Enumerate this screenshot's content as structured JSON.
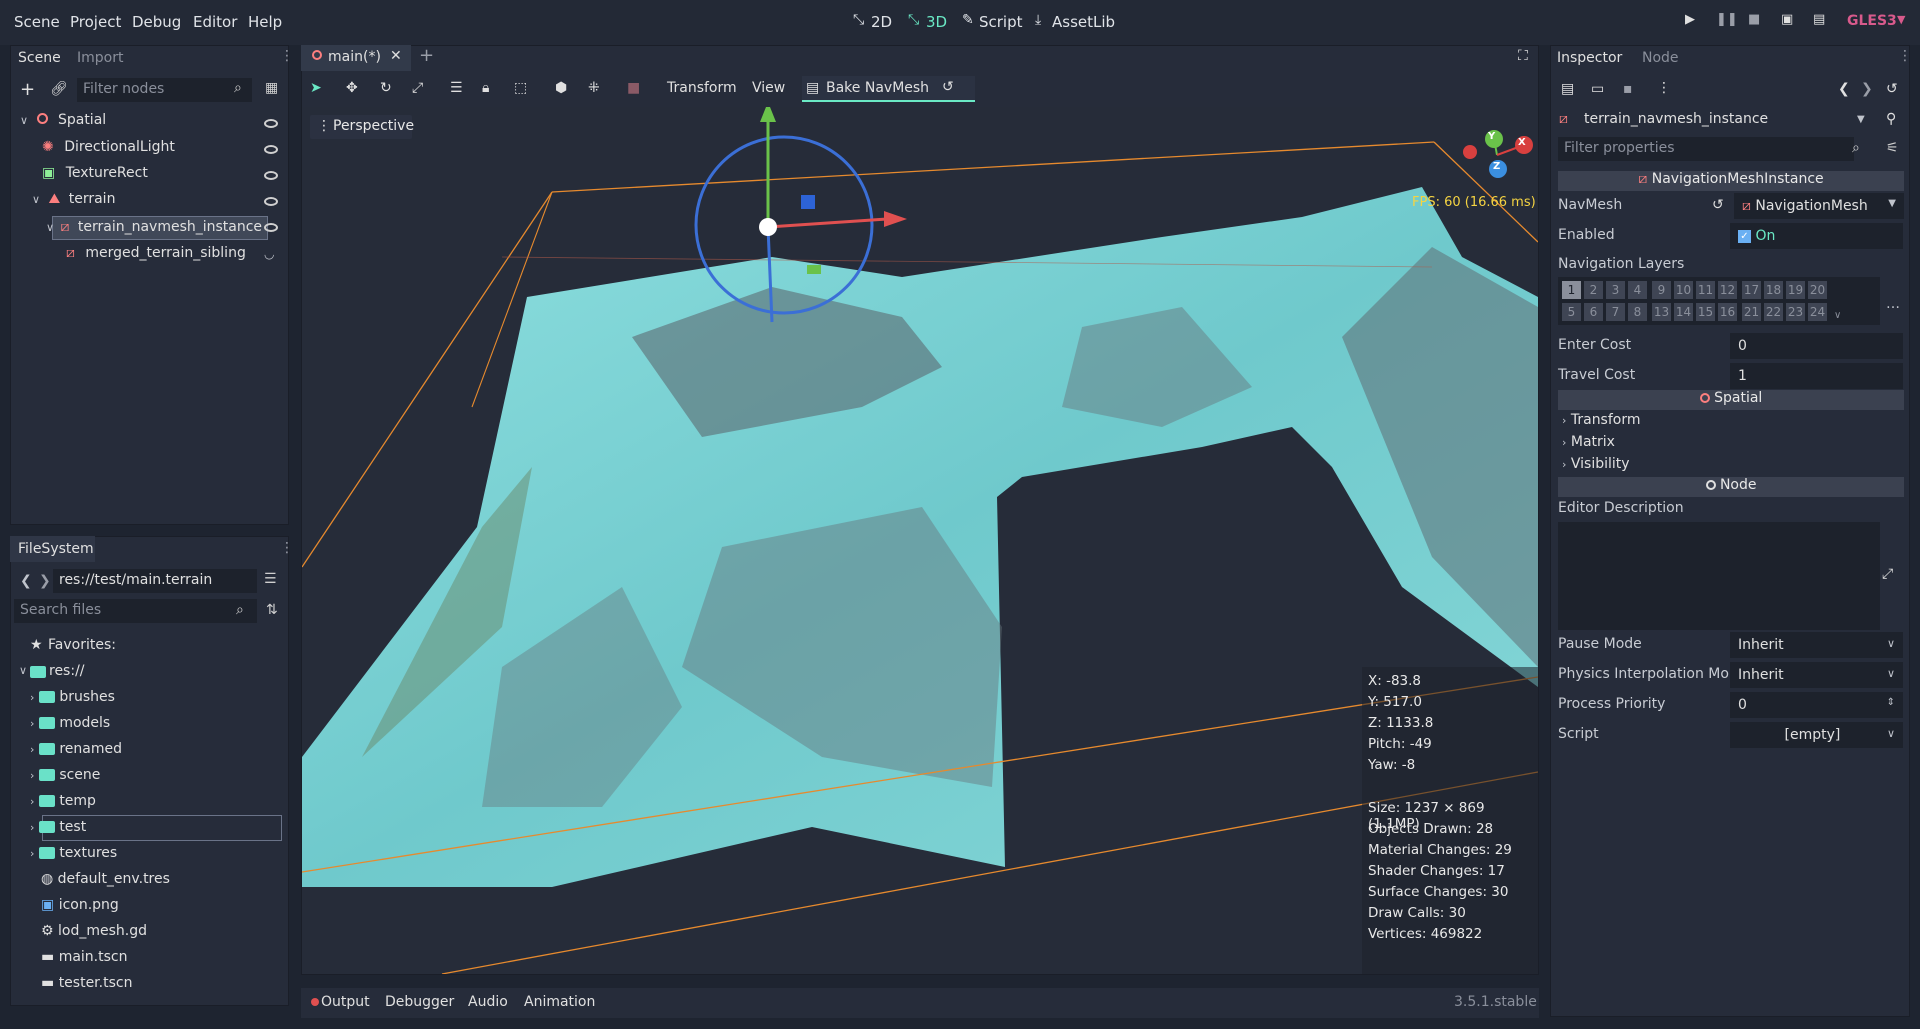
{
  "menu": {
    "scene": "Scene",
    "project": "Project",
    "debug": "Debug",
    "editor": "Editor",
    "help": "Help"
  },
  "modes": {
    "m2d": "2D",
    "m3d": "3D",
    "script": "Script",
    "assetlib": "AssetLib"
  },
  "renderer": "GLES3",
  "scene_dock": {
    "tab_scene": "Scene",
    "tab_import": "Import",
    "filter_placeholder": "Filter nodes",
    "nodes": [
      {
        "label": "Spatial"
      },
      {
        "label": "DirectionalLight"
      },
      {
        "label": "TextureRect"
      },
      {
        "label": "terrain"
      },
      {
        "label": "terrain_navmesh_instance"
      },
      {
        "label": "merged_terrain_sibling"
      }
    ]
  },
  "filesystem": {
    "title": "FileSystem",
    "path": "res://test/main.terrain",
    "search_placeholder": "Search files",
    "favorites": "Favorites:",
    "root": "res://",
    "folders": [
      "brushes",
      "models",
      "renamed",
      "scene",
      "temp",
      "test",
      "textures"
    ],
    "files": [
      "default_env.tres",
      "icon.png",
      "lod_mesh.gd",
      "main.tscn",
      "tester.tscn"
    ]
  },
  "editor_tab": "main(*)",
  "toolbar": {
    "transform": "Transform",
    "view": "View",
    "bake": "Bake NavMesh"
  },
  "viewport": {
    "perspective": "Perspective",
    "fps": "FPS: 60 (16.66 ms)",
    "gizmo": {
      "y": "Y",
      "x": "X",
      "z": "Z"
    },
    "camera": [
      "X: -83.8",
      "Y: 517.0",
      "Z: 1133.8",
      "Pitch: -49",
      "Yaw: -8"
    ],
    "stats": [
      "Size: 1237 × 869 (1.1MP)",
      "Objects Drawn: 28",
      "Material Changes: 29",
      "Shader Changes: 17",
      "Surface Changes: 30",
      "Draw Calls: 30",
      "Vertices: 469822"
    ]
  },
  "bottom": {
    "output": "Output",
    "debugger": "Debugger",
    "audio": "Audio",
    "animation": "Animation",
    "version": "3.5.1.stable"
  },
  "inspector": {
    "tab_inspector": "Inspector",
    "tab_node": "Node",
    "object": "terrain_navmesh_instance",
    "filter_placeholder": "Filter properties",
    "class_header": "NavigationMeshInstance",
    "navmesh_label": "NavMesh",
    "navmesh_value": "NavigationMesh",
    "enabled_label": "Enabled",
    "enabled_value": "On",
    "layers_label": "Navigation Layers",
    "layers_row1": [
      "1",
      "2",
      "3",
      "4",
      "9",
      "10",
      "11",
      "12",
      "17",
      "18",
      "19",
      "20"
    ],
    "layers_row2": [
      "5",
      "6",
      "7",
      "8",
      "13",
      "14",
      "15",
      "16",
      "21",
      "22",
      "23",
      "24"
    ],
    "enter_cost_label": "Enter Cost",
    "enter_cost": "0",
    "travel_cost_label": "Travel Cost",
    "travel_cost": "1",
    "spatial_header": "Spatial",
    "groups": [
      "Transform",
      "Matrix",
      "Visibility"
    ],
    "node_header": "Node",
    "editor_description": "Editor Description",
    "pause_mode_label": "Pause Mode",
    "pause_mode": "Inherit",
    "physics_label": "Physics Interpolation Mo",
    "physics": "Inherit",
    "priority_label": "Process Priority",
    "priority": "0",
    "script_label": "Script",
    "script": "[empty]"
  },
  "colors": {
    "accent": "#6ae9c5",
    "node_red": "#fc7f7f",
    "terrain_cyan": "#7fd6d6",
    "bounds": "#e68a2e",
    "fps": "#f5d442",
    "renderer": "#d85a8c"
  }
}
